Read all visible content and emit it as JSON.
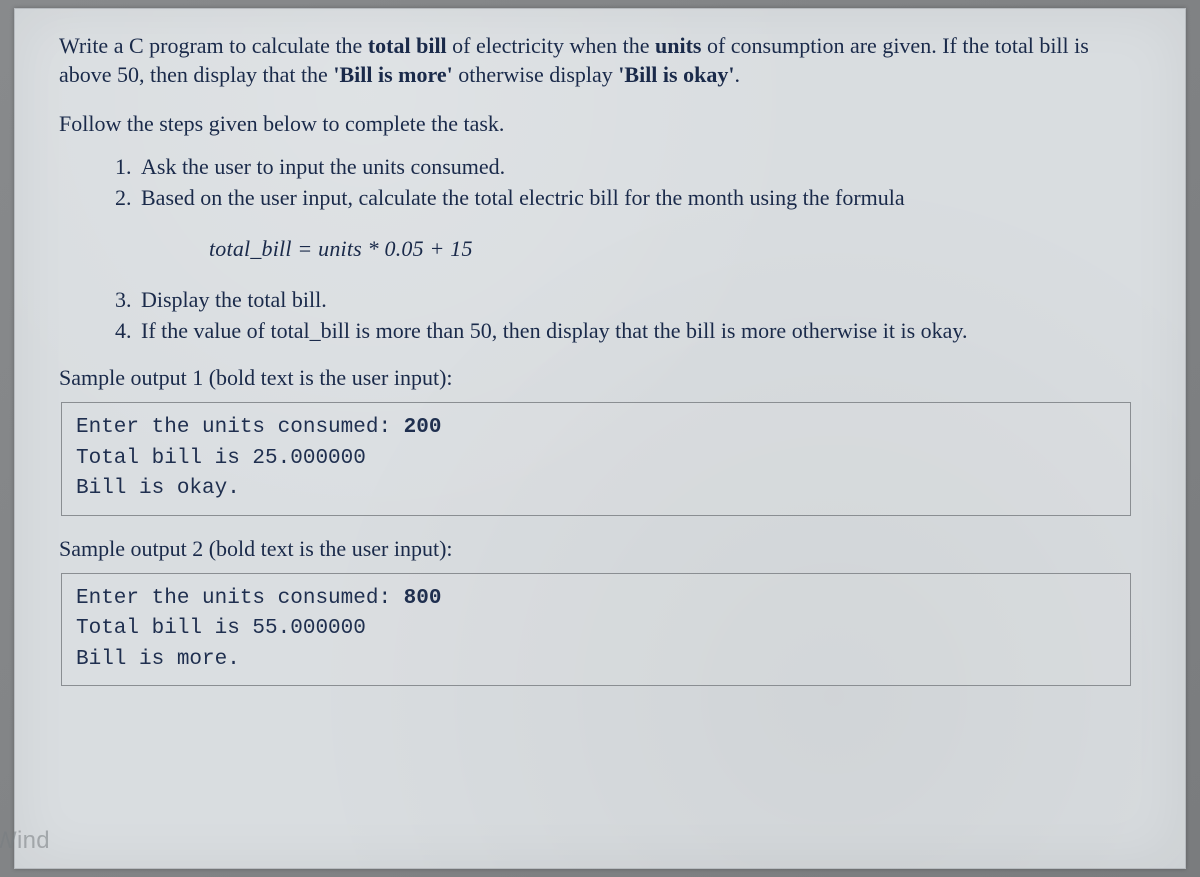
{
  "intro": {
    "p1a": "Write a C program to calculate the ",
    "p1b": "total bill",
    "p1c": " of electricity when the ",
    "p1d": "units",
    "p1e": " of consumption are given. If the total bill is above 50, then display that the ",
    "p1f": "'Bill is more'",
    "p1g": " otherwise display ",
    "p1h": "'Bill is okay'",
    "p1i": "."
  },
  "follow": "Follow the steps given below to complete the task.",
  "steps": {
    "s1": "Ask the user to input the units consumed.",
    "s2": "Based on the user input, calculate the total electric bill for the month using the formula",
    "s3": "Display the total bill.",
    "s4": "If the value of total_bill is more than 50, then display that the bill is more otherwise it is okay."
  },
  "formula": "total_bill = units * 0.05 + 15",
  "sample1_label": "Sample output 1 (bold text is the user input):",
  "sample1": {
    "line1a": "Enter the units consumed: ",
    "line1b": "200",
    "line2": "Total bill is 25.000000",
    "line3": "Bill is okay."
  },
  "sample2_label": "Sample output 2 (bold text is the user input):",
  "sample2": {
    "line1a": "Enter the units consumed: ",
    "line1b": "800",
    "line2": "Total bill is 55.000000",
    "line3": "Bill is more."
  },
  "watermark": "Wind"
}
